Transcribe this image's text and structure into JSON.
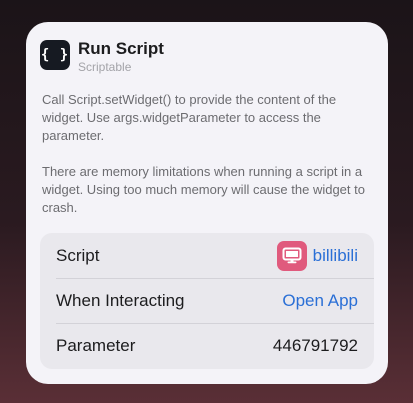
{
  "widget": {
    "icon": "curly-braces-icon",
    "icon_glyph": "{ }",
    "title": "Run Script",
    "subtitle": "Scriptable",
    "description": [
      "Call Script.setWidget() to provide the content of the widget. Use args.widgetParameter to access the parameter.",
      "There are memory limitations when running a script in a widget. Using too much memory will cause the widget to crash."
    ]
  },
  "settings": {
    "script": {
      "label": "Script",
      "value": "billibili",
      "icon": "tv-icon",
      "icon_color": "#e05a7d"
    },
    "when_interacting": {
      "label": "When Interacting",
      "value": "Open App"
    },
    "parameter": {
      "label": "Parameter",
      "value": "446791792"
    }
  },
  "colors": {
    "accent": "#2a6fd6",
    "card_background": "#f4f3f8",
    "settings_background": "#e9e8ed"
  }
}
